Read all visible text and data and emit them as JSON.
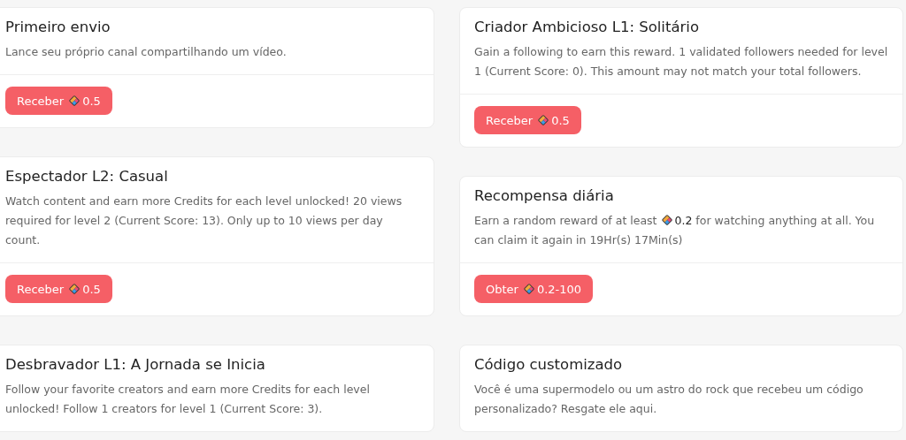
{
  "columns": [
    {
      "cards": [
        {
          "title": "Primeiro envio",
          "description": [
            {
              "text": "Lance seu próprio canal compartilhando um vídeo."
            }
          ],
          "button": {
            "label": "Receber",
            "amount": "0.5"
          }
        },
        {
          "title": "Espectador L2: Casual",
          "description": [
            {
              "text": "Watch content and earn more Credits for each level unlocked! 20 views required for level 2 (Current Score: 13). Only up to 10 views per day count."
            }
          ],
          "button": {
            "label": "Receber",
            "amount": "0.5"
          }
        },
        {
          "title": "Desbravador L1: A Jornada se Inicia",
          "description": [
            {
              "text": "Follow your favorite creators and earn more Credits for each level unlocked! Follow 1 creators for level 1 (Current Score: 3)."
            }
          ]
        }
      ]
    },
    {
      "cards": [
        {
          "title": "Criador Ambicioso L1: Solitário",
          "description": [
            {
              "text": "Gain a following to earn this reward. 1 validated followers needed for level 1 (Current Score: 0). This amount may not match your total followers."
            }
          ],
          "button": {
            "label": "Receber",
            "amount": "0.5"
          }
        },
        {
          "title": "Recompensa diária",
          "description": [
            {
              "text": "Earn a random reward of at least "
            },
            {
              "kind": "credit",
              "text": "0.2"
            },
            {
              "text": " for watching anything at all. You can claim it again in 19Hr(s) 17Min(s)"
            }
          ],
          "button": {
            "label": "Obter",
            "amount": "0.2-100"
          }
        },
        {
          "title": "Código customizado",
          "description": [
            {
              "text": "Você é uma supermodelo ou um astro do rock que recebeu um código personalizado? Resgate ele aqui."
            }
          ]
        }
      ]
    }
  ]
}
